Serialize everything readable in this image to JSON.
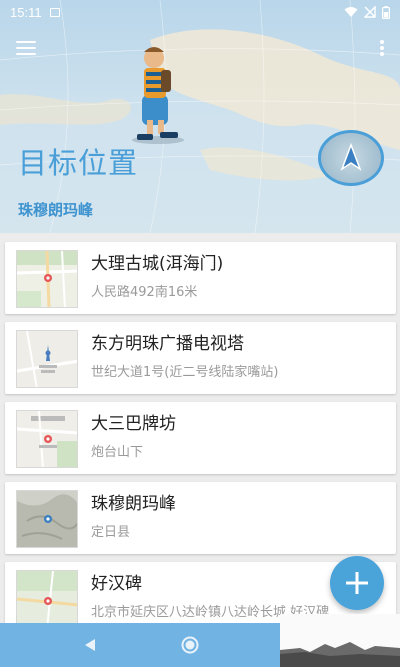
{
  "status_bar": {
    "time": "15:11",
    "icons": [
      "image-icon",
      "wifi-icon",
      "no-sim-icon",
      "battery-icon"
    ]
  },
  "header": {
    "title": "目标位置",
    "subtitle": "珠穆朗玛峰",
    "accent_color": "#4a9fd8",
    "menu_icon": "hamburger-menu-icon",
    "more_icon": "more-vert-icon"
  },
  "places": [
    {
      "name": "大理古城(洱海门)",
      "address": "人民路492南16米"
    },
    {
      "name": "东方明珠广播电视塔",
      "address": "世纪大道1号(近二号线陆家嘴站)"
    },
    {
      "name": "大三巴牌坊",
      "address": "炮台山下"
    },
    {
      "name": "珠穆朗玛峰",
      "address": "定日县"
    },
    {
      "name": "好汉碑",
      "address": "北京市延庆区八达岭镇八达岭长城 好汉碑"
    }
  ],
  "fab": {
    "icon": "plus-icon",
    "color": "#4aa4da"
  },
  "nav_bar": {
    "back_icon": "back-triangle-icon",
    "home_icon": "home-circle-icon",
    "color": "#71b3e3"
  }
}
